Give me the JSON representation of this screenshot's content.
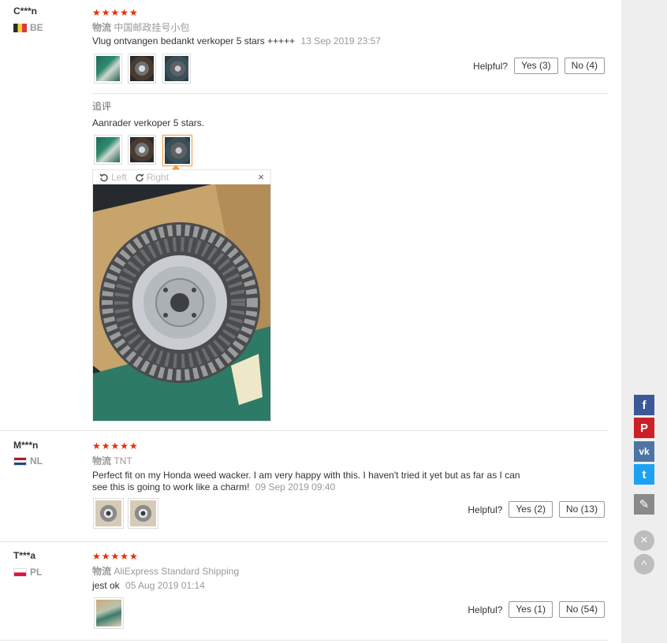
{
  "reviews": [
    {
      "user": "C***n",
      "country": "BE",
      "stars": "★★★★★",
      "logistics_label": "物流",
      "logistics": "中国邮政挂号小包",
      "text": "Vlug ontvangen bedankt verkoper 5 stars +++++",
      "date": "13 Sep 2019 23:57",
      "helpful_label": "Helpful?",
      "yes": "Yes (3)",
      "no": "No (4)",
      "followup_label": "追评",
      "followup_text": "Aanrader verkoper 5 stars.",
      "viewer": {
        "left": "Left",
        "right": "Right",
        "close": "×"
      }
    },
    {
      "user": "M***n",
      "country": "NL",
      "stars": "★★★★★",
      "logistics_label": "物流",
      "logistics": "TNT",
      "text_line1": "Perfect fit on my Honda weed wacker. I am very happy with this. I haven't tried it yet but as far as I can",
      "text_line2": "see this is going to work like a charm!",
      "date": "09 Sep 2019 09:40",
      "helpful_label": "Helpful?",
      "yes": "Yes (2)",
      "no": "No (13)"
    },
    {
      "user": "T***a",
      "country": "PL",
      "stars": "★★★★★",
      "logistics_label": "物流",
      "logistics": "AliExpress Standard Shipping",
      "text": "jest ok",
      "date": "05 Aug 2019 01:14",
      "helpful_label": "Helpful?",
      "yes": "Yes (1)",
      "no": "No (54)"
    }
  ],
  "social": {
    "facebook": "f",
    "pinterest": "P",
    "vk": "vk",
    "twitter": "t",
    "edit": "✎",
    "close": "×",
    "top": "^"
  },
  "colors": {
    "star": "#e62e04",
    "facebook": "#3b5998",
    "pinterest": "#cb2027",
    "vk": "#4c75a3",
    "twitter": "#1da1f2",
    "edit": "#8a8a8a"
  }
}
